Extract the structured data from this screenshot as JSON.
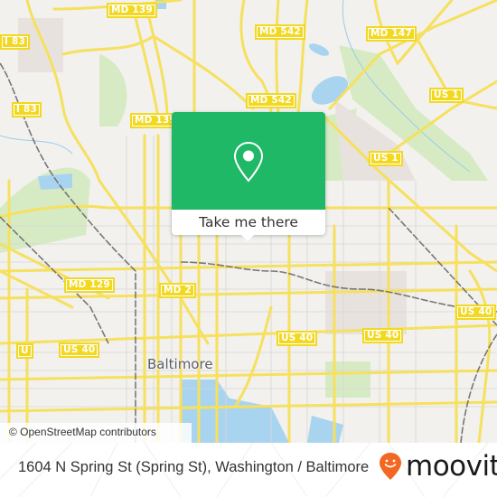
{
  "map": {
    "route_shields": [
      {
        "id": "md139-top",
        "label": "MD 139"
      },
      {
        "id": "md542-top",
        "label": "MD 542"
      },
      {
        "id": "md147",
        "label": "MD 147"
      },
      {
        "id": "md542-mid",
        "label": "MD 542"
      },
      {
        "id": "md139-mid",
        "label": "MD 139"
      },
      {
        "id": "i83-top",
        "label": "I 83"
      },
      {
        "id": "i83-left",
        "label": "I 83"
      },
      {
        "id": "us1-right",
        "label": "US 1"
      },
      {
        "id": "us1-mid",
        "label": "US 1"
      },
      {
        "id": "md129",
        "label": "MD 129"
      },
      {
        "id": "md2",
        "label": "MD 2"
      },
      {
        "id": "us40-left",
        "label": "US 40"
      },
      {
        "id": "us40-center",
        "label": "US 40"
      },
      {
        "id": "us40-mid",
        "label": "US 40"
      },
      {
        "id": "us40-right",
        "label": "US 40"
      },
      {
        "id": "us40-edge",
        "label": "US 40"
      },
      {
        "id": "u-edge",
        "label": "U"
      }
    ],
    "city_label": "Baltimore",
    "attribution": "© OpenStreetMap contributors",
    "colors": {
      "land": "#f2f1ee",
      "road": "#f6e05e",
      "water": "#a9d4f0",
      "park": "#d6ebc4",
      "rail": "#777777",
      "popup_green": "#1eb866"
    }
  },
  "popup": {
    "icon": "location-pin-icon",
    "cta_label": "Take me there"
  },
  "footer": {
    "address": "1604 N Spring St (Spring St), Washington / Baltimore",
    "brand_name": "moovit",
    "brand_color": "#f26722",
    "brand_icon": "moovit-smiley-pin-icon"
  }
}
